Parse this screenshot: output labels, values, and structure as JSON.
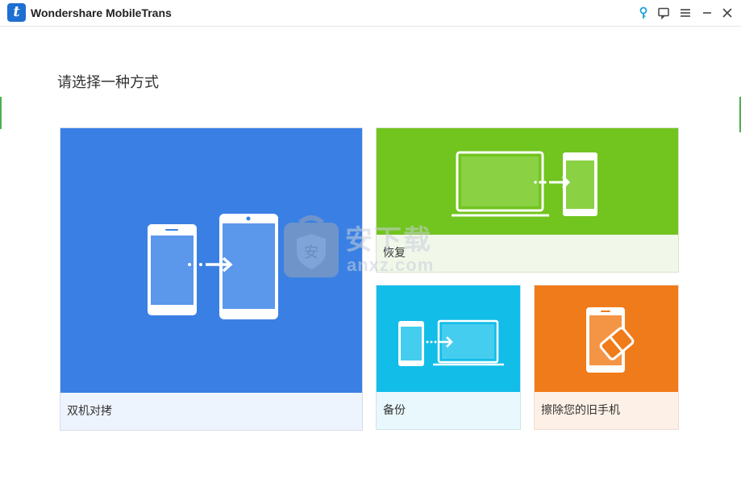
{
  "window": {
    "title": "Wondershare MobileTrans",
    "logo_letter": "t",
    "buttons": [
      "key-icon",
      "feedback-icon",
      "menu-icon",
      "minimize-icon",
      "close-icon"
    ]
  },
  "main": {
    "heading": "请选择一种方式"
  },
  "tiles": [
    {
      "id": "transfer",
      "label": "双机对拷",
      "color": "#3a80e4",
      "icon": "phone-to-phone-icon"
    },
    {
      "id": "restore",
      "label": "恢复",
      "color": "#72c41f",
      "icon": "computer-to-phone-icon"
    },
    {
      "id": "backup",
      "label": "备份",
      "color": "#12bde8",
      "icon": "phone-to-computer-icon"
    },
    {
      "id": "erase",
      "label": "擦除您的旧手机",
      "color": "#f07b1a",
      "icon": "phone-eraser-icon"
    }
  ],
  "watermark": {
    "text": "安下载",
    "sub": "anxz.com",
    "shield_char": "安"
  }
}
